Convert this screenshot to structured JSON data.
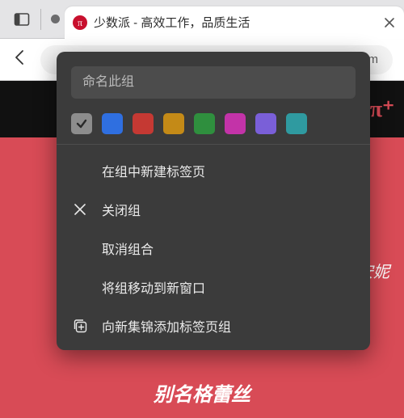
{
  "tab": {
    "title": "少数派 - 高效工作，品质生活",
    "favicon_bg": "#c8102e",
    "favicon_glyph": "π"
  },
  "addressbar": {
    "visible_text": "i.com"
  },
  "page": {
    "logo": "π⁺",
    "snippet_right": "、安妮",
    "snippet_bottom": "别名格蕾丝"
  },
  "popup": {
    "name_placeholder": "命名此组",
    "colors": [
      {
        "id": "grey",
        "hex": "#8d8d8d",
        "selected": true
      },
      {
        "id": "blue",
        "hex": "#2f6fe0"
      },
      {
        "id": "red",
        "hex": "#c53933"
      },
      {
        "id": "yellow",
        "hex": "#c48a17"
      },
      {
        "id": "green",
        "hex": "#2f8f3e"
      },
      {
        "id": "pink",
        "hex": "#c333a8"
      },
      {
        "id": "purple",
        "hex": "#7a5fd8"
      },
      {
        "id": "teal",
        "hex": "#2f9aa0"
      }
    ],
    "menu": {
      "new_tab": "在组中新建标签页",
      "close_group": "关闭组",
      "ungroup": "取消组合",
      "move_window": "将组移动到新窗口",
      "add_collection": "向新集锦添加标签页组"
    }
  }
}
